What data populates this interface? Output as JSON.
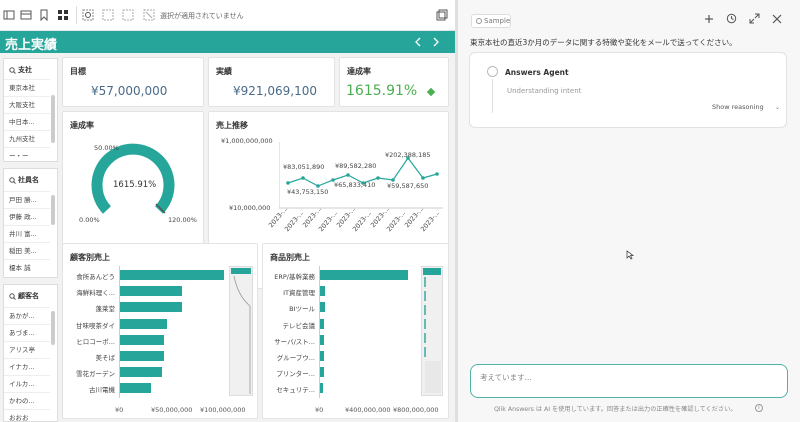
{
  "toolbar": {
    "selection_status": "選択が適用されていません"
  },
  "sheet": {
    "title": "売上実績",
    "filters": [
      {
        "title": "支社",
        "items": [
          "東京本社",
          "大阪支社",
          "中日本...",
          "九州支社",
          "ー・ー"
        ]
      },
      {
        "title": "社員名",
        "items": [
          "戸田 勝...",
          "伊藤 政...",
          "井川 富...",
          "稲田 美...",
          "榎本 誠"
        ]
      },
      {
        "title": "顧客名",
        "items": [
          "あかが...",
          "あづま...",
          "アリス亭",
          "イナカ...",
          "イルカ...",
          "かわの...",
          "おおお"
        ]
      }
    ],
    "kpis": [
      {
        "title": "目標",
        "value": "¥57,000,000"
      },
      {
        "title": "実績",
        "value": "¥921,069,100"
      },
      {
        "title": "達成率",
        "value": "1615.91%",
        "color": "#4caf50"
      }
    ],
    "gauge": {
      "title": "達成率",
      "value_label": "1615.91%",
      "min_label": "0.00%",
      "mid_label": "50.00%",
      "max_label": "120.00%",
      "accent": "#26a69a"
    },
    "trend": {
      "title": "売上推移",
      "y_top_label": "¥1,000,000,000",
      "y_bottom_label": "¥10,000,000",
      "x_label": "2023-...",
      "point_labels": [
        "¥83,051,890",
        "¥43,753,150",
        "¥89,582,280",
        "¥65,833,410",
        "¥202,388,185",
        "¥59,587,650"
      ]
    },
    "customer_chart": {
      "title": "顧客別売上",
      "categories": [
        "食所あんどう",
        "海鮮料理く...",
        "蓬莱堂",
        "甘味喫茶ダイ",
        "ヒロコーポ...",
        "美そば",
        "雪花ガーデン",
        "古川電機"
      ],
      "values": [
        1,
        0.6,
        0.6,
        0.45,
        0.42,
        0.42,
        0.4,
        0.3
      ],
      "ticks": [
        "¥0",
        "¥50,000,000",
        "¥100,000,000"
      ]
    },
    "product_chart": {
      "title": "商品別売上",
      "categories": [
        "ERP/基幹業務",
        "IT資産管理",
        "BIツール",
        "テレビ会議",
        "サーバ/スト...",
        "グループウ...",
        "プリンター...",
        "セキュリテ..."
      ],
      "values": [
        1,
        0.06,
        0.06,
        0.05,
        0.05,
        0.04,
        0.04,
        0.03
      ],
      "ticks": [
        "¥0",
        "¥400,000,000",
        "¥800,000,000"
      ]
    }
  },
  "assistant": {
    "sample_label": "Sample",
    "question": "東京本社の直近3か月のデータに関する特徴や変化をメールで送ってください。",
    "agent_name": "Answers Agent",
    "status": "Understanding intent",
    "show_reasoning": "Show reasoning",
    "input_placeholder": "考えています...",
    "disclaimer": "Qlik Answers は AI を使用しています。回答または出力の正確性を確認してください。"
  }
}
